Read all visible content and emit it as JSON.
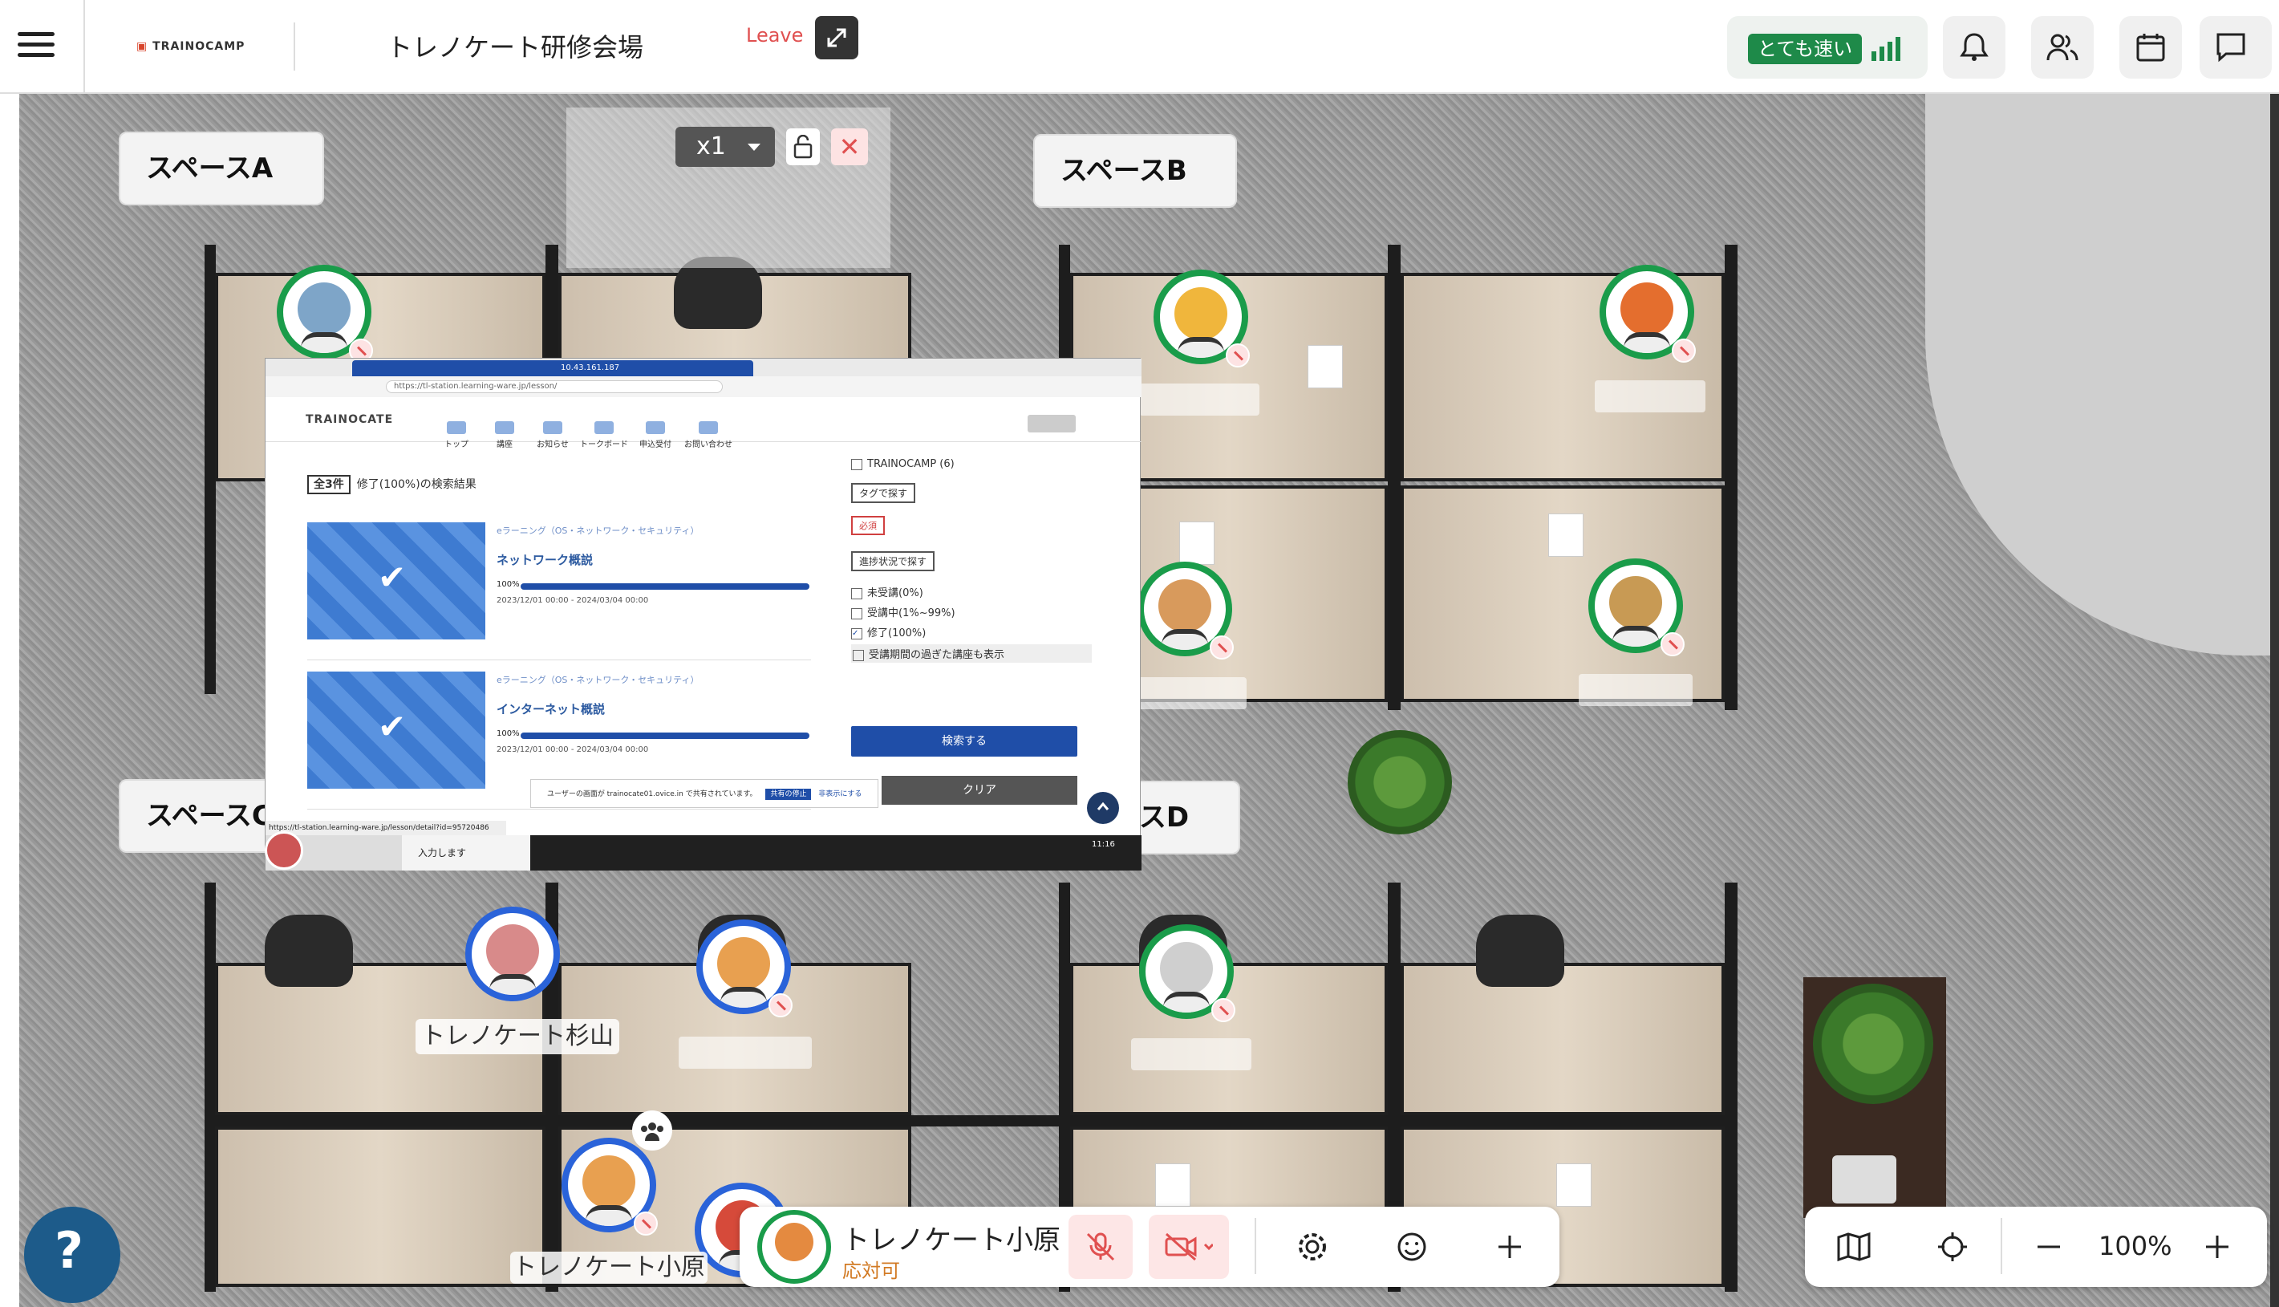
{
  "header": {
    "logo": "TRAINOCAMP",
    "title": "トレノケート研修会場",
    "speed_badge": "とても速い"
  },
  "spaces": {
    "a": "スペースA",
    "b": "スペースB",
    "c": "スペースC",
    "d": "スペースD"
  },
  "zoom_control": {
    "level": "x1",
    "close": "✕"
  },
  "people": {
    "sugiyama": "トレノケート杉山",
    "ohara": "トレノケート小原"
  },
  "share": {
    "leave": "Leave",
    "tab_ip": "10.43.161.187",
    "url": "https://tl-station.learning-ware.jp/lesson/",
    "brand": "TRAINOCATE",
    "nav": [
      "トップ",
      "講座",
      "お知らせ",
      "トークボード",
      "申込受付",
      "お問い合わせ"
    ],
    "result_total": "全3件",
    "result_caption": "修了(100%)の検索結果",
    "courses": [
      {
        "category": "eラーニング（OS・ネットワーク・セキュリティ）",
        "title": "ネットワーク概説",
        "percent": "100%",
        "progress": 1.0,
        "dates": "2023/12/01 00:00 - 2024/03/04 00:00"
      },
      {
        "category": "eラーニング（OS・ネットワーク・セキュリティ）",
        "title": "インターネット概説",
        "percent": "100%",
        "progress": 1.0,
        "dates": "2023/12/01 00:00 - 2024/03/04 00:00"
      }
    ],
    "filter_trainocamp": "TRAINOCAMP (6)",
    "tag_search": "タグで探す",
    "required_tag": "必須",
    "status_search": "進捗状況で探す",
    "status_options": [
      "未受講(0%)",
      "受講中(1%~99%)",
      "修了(100%)"
    ],
    "expired_option": "受講期間の過ぎた講座も表示",
    "search_button": "検索する",
    "clear_button": "クリア",
    "notice_text": "ユーザーの画面が trainocate01.ovice.in で共有されています。",
    "notice_stop": "共有の停止",
    "notice_hide": "非表示にする",
    "status_url": "https://tl-station.learning-ware.jp/lesson/detail?id=95720486",
    "download_label": "入力します",
    "clock": "11:16"
  },
  "bottom": {
    "my_name": "トレノケート小原",
    "my_status": "応対可",
    "zoom_percent": "100%"
  },
  "colors": {
    "speed_badge": "#1e8a49",
    "avatar_ring_green": "#1a9c4a",
    "avatar_ring_blue": "#2a63d9",
    "mute_red": "#e05050",
    "status_orange": "#d27a24",
    "help_button": "#1d5b8a"
  },
  "icons": {
    "menu": "hamburger-icon",
    "bell": "bell-icon",
    "people": "people-icon",
    "calendar": "calendar-icon",
    "chat": "chat-icon",
    "mic_off": "mic-off-icon",
    "camera_off": "camera-off-icon",
    "settings": "gear-icon",
    "reaction": "smile-icon",
    "add": "plus-icon",
    "map": "map-icon",
    "locate": "crosshair-icon"
  }
}
